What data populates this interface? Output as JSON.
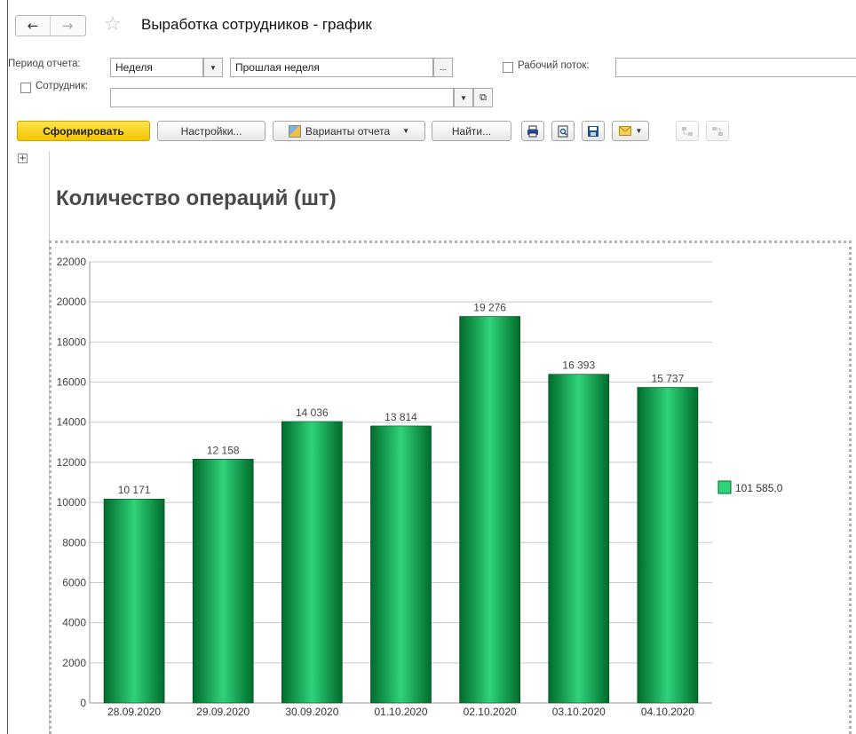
{
  "window": {
    "title": "Выработка сотрудников - график"
  },
  "nav": {
    "back": "←",
    "forward": "→",
    "favorite": "☆"
  },
  "form": {
    "period_label": "Период отчета:",
    "period_type": "Неделя",
    "period_value": "Прошлая неделя",
    "period_more": "...",
    "workflow_label": "Рабочий поток:",
    "workflow_value": "",
    "employee_label": "Сотрудник:",
    "employee_value": ""
  },
  "toolbar": {
    "generate": "Сформировать",
    "settings": "Настройки...",
    "variants": "Варианты отчета",
    "find": "Найти..."
  },
  "report": {
    "expand": "+",
    "title": "Количество операций (шт)"
  },
  "chart_data": {
    "type": "bar",
    "categories": [
      "28.09.2020",
      "29.09.2020",
      "30.09.2020",
      "01.10.2020",
      "02.10.2020",
      "03.10.2020",
      "04.10.2020"
    ],
    "values": [
      10171,
      12158,
      14036,
      13814,
      19276,
      16393,
      15737
    ],
    "value_labels": [
      "10 171",
      "12 158",
      "14 036",
      "13 814",
      "19 276",
      "16 393",
      "15 737"
    ],
    "y_ticks": [
      0,
      2000,
      4000,
      6000,
      8000,
      10000,
      12000,
      14000,
      16000,
      18000,
      20000,
      22000
    ],
    "ylim": [
      0,
      22000
    ],
    "grid": true,
    "legend": {
      "placement": "right",
      "entries": [
        "101 585,0"
      ]
    },
    "colors": {
      "bar_dark": "#006b2c",
      "bar_light": "#2fd37a"
    }
  }
}
